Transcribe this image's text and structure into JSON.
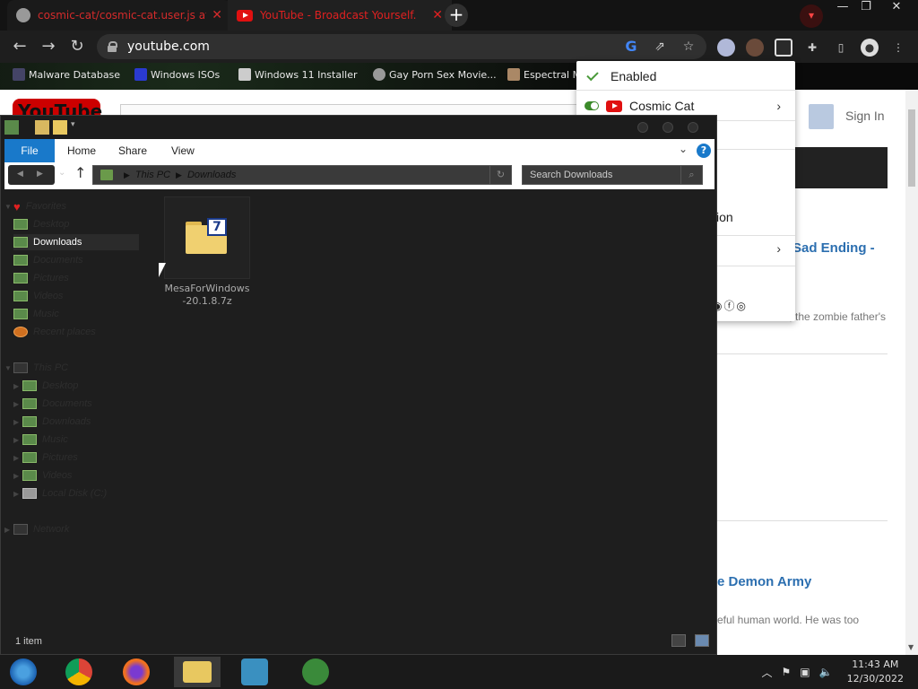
{
  "browser": {
    "tabs": [
      {
        "label": "cosmic-cat/cosmic-cat.user.js at",
        "close": "✕"
      },
      {
        "label": "YouTube - Broadcast Yourself.",
        "close": "✕"
      }
    ],
    "new_tab": "+",
    "url": "youtube.com",
    "bookmarks": [
      {
        "label": "Malware Database"
      },
      {
        "label": "Windows ISOs"
      },
      {
        "label": "Windows 11 Installer"
      },
      {
        "label": "Gay Porn Sex Movie..."
      },
      {
        "label": "Espectral M"
      }
    ],
    "colors": {
      "tab_text": "#d42b2b",
      "chrome_bg": "#1e1e1e"
    }
  },
  "youtube": {
    "logo": "YouTube",
    "sign_in": "Sign In",
    "video1_title": "Sad Ending -",
    "video1_desc": "of his sister, the zombie father's",
    "video2_title": "e Demon Army",
    "video2_desc": "eful human world. He was too",
    "partial_text": "ion",
    "partial_dot": "."
  },
  "extension_menu": {
    "enabled_label": "Enabled",
    "item_label": "Cosmic Cat",
    "social_icons": "◉ⓕ◎"
  },
  "explorer": {
    "ribbon_tabs": {
      "file": "File",
      "home": "Home",
      "share": "Share",
      "view": "View"
    },
    "help": "?",
    "breadcrumb": {
      "root": "This PC",
      "current": "Downloads"
    },
    "search_placeholder": "Search Downloads",
    "nav": {
      "favorites": "Favorites",
      "fav_items": [
        "Desktop",
        "Downloads",
        "Documents",
        "Pictures",
        "Videos",
        "Music",
        "Recent places"
      ],
      "this_pc": "This PC",
      "pc_items": [
        "Desktop",
        "Documents",
        "Downloads",
        "Music",
        "Pictures",
        "Videos",
        "Local Disk (C:)"
      ],
      "network": "Network"
    },
    "file": {
      "name": "MesaForWindows-20.1.8.7z",
      "badge": "7"
    },
    "status": "1 item"
  },
  "taskbar": {
    "time": "11:43 AM",
    "date": "12/30/2022"
  }
}
